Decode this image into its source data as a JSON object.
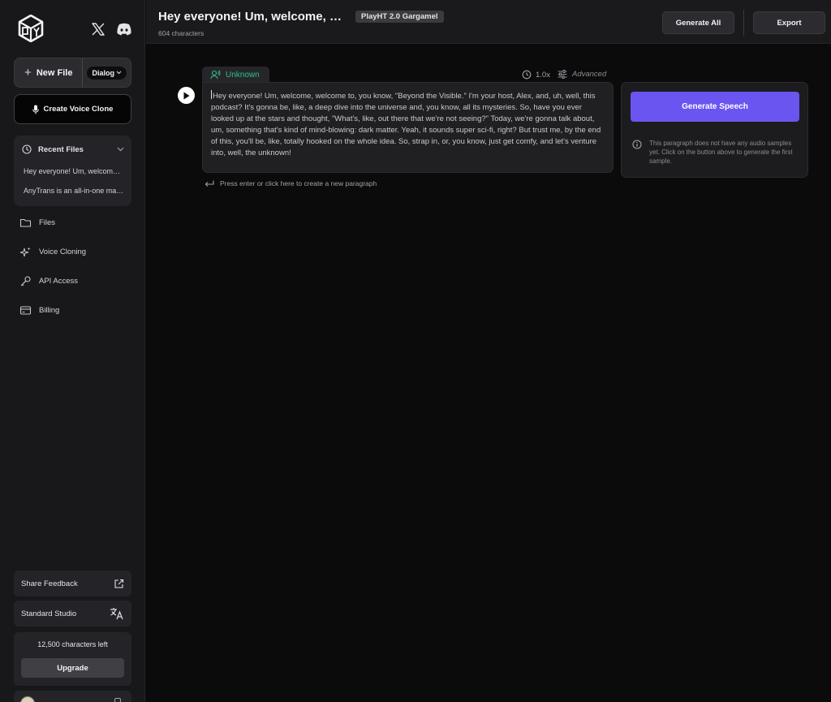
{
  "sidebar": {
    "new_file_label": "New File",
    "mode_label": "Dialog",
    "voice_clone_label": "Create Voice Clone",
    "recent_files": {
      "title": "Recent Files",
      "items": [
        "Hey everyone! Um, welcome, welcome to, you know, \"Beyond the Visible.\"",
        "AnyTrans is an all-in-one manager"
      ]
    },
    "nav": [
      {
        "label": "Files",
        "icon": "folder-icon"
      },
      {
        "label": "Voice Cloning",
        "icon": "sparkles-icon"
      },
      {
        "label": "API Access",
        "icon": "key-icon"
      },
      {
        "label": "Billing",
        "icon": "credit-card-icon"
      }
    ],
    "share_feedback_label": "Share Feedback",
    "studio_label": "Standard Studio",
    "credits_left": "12,500 characters left",
    "upgrade_label": "Upgrade"
  },
  "header": {
    "title": "Hey everyone! Um, welcome, welcome to, you know, \"Beyond the Visible.\"",
    "model": "PlayHT 2.0 Gargamel",
    "char_count": "604 characters",
    "generate_all_label": "Generate All",
    "export_label": "Export"
  },
  "editor": {
    "speaker": "Unknown",
    "speed": "1.0x",
    "advanced_label": "Advanced",
    "paragraph_text": "Hey everyone! Um, welcome, welcome to, you know, \"Beyond the Visible.\" I'm your host, Alex, and, uh, well, this podcast? It's gonna be, like, a deep dive into the universe and, you know, all its mysteries. So, have you ever looked up at the stars and thought, \"What's, like, out there that we're not seeing?\" Today, we're gonna talk about, um, something that's kind of mind-blowing: dark matter. Yeah, it sounds super sci-fi, right? But trust me, by the end of this, you'll be, like, totally hooked on the whole idea. So, strap in, or, you know, just get comfy, and let's venture into, well, the unknown!",
    "new_paragraph_hint": "Press enter or click here to create a new paragraph",
    "generate_speech_label": "Generate Speech",
    "no_samples_info": "This paragraph does not have any audio samples yet. Click on the button above to generate the first sample."
  },
  "colors": {
    "accent": "#6a55f0",
    "speaker": "#2fbf8f",
    "background": "#0b0b0c",
    "sidebar": "#18181a"
  }
}
